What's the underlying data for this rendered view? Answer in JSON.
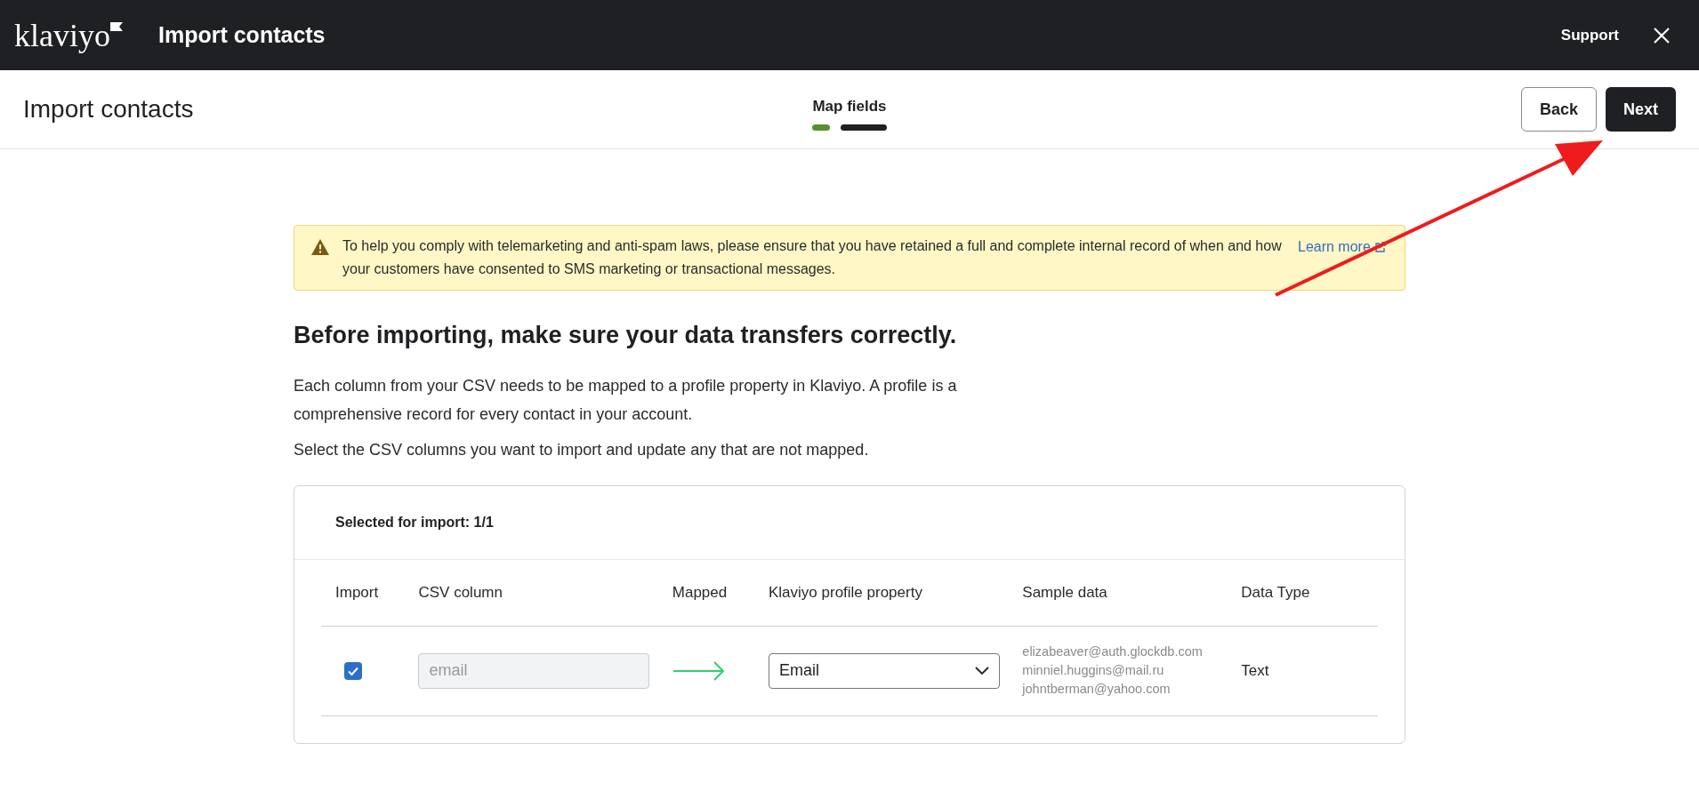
{
  "top_bar": {
    "logo": "klaviyo",
    "title": "Import contacts",
    "support_link": "Support"
  },
  "header": {
    "title": "Import contacts",
    "step_label": "Map fields",
    "steps": [
      {
        "kind": "done"
      },
      {
        "kind": "current"
      }
    ],
    "back_button": "Back",
    "next_button": "Next"
  },
  "notice": {
    "text": "To help you comply with telemarketing and anti-spam laws, please ensure that you have retained a full and complete internal record of when and how your customers have consented to SMS marketing or transactional messages.",
    "link": "Learn more"
  },
  "heading": "Before importing, make sure your data transfers correctly.",
  "paragraphs": [
    "Each column from your CSV needs to be mapped to a profile property in Klaviyo. A profile is a comprehensive record for every contact in your account.",
    "Select the CSV columns you want to import and update any that are not mapped."
  ],
  "mapping": {
    "summary": "Selected for import: 1/1",
    "columns": [
      "Import",
      "CSV column",
      "Mapped",
      "Klaviyo profile property",
      "Sample data",
      "Data Type"
    ],
    "rows": [
      {
        "checked": true,
        "csv_column": "email",
        "property": "Email",
        "samples": [
          "elizabeaver@auth.glockdb.com",
          "minniel.huggins@mail.ru",
          "johntberman@yahoo.com"
        ],
        "data_type": "Text"
      }
    ]
  }
}
